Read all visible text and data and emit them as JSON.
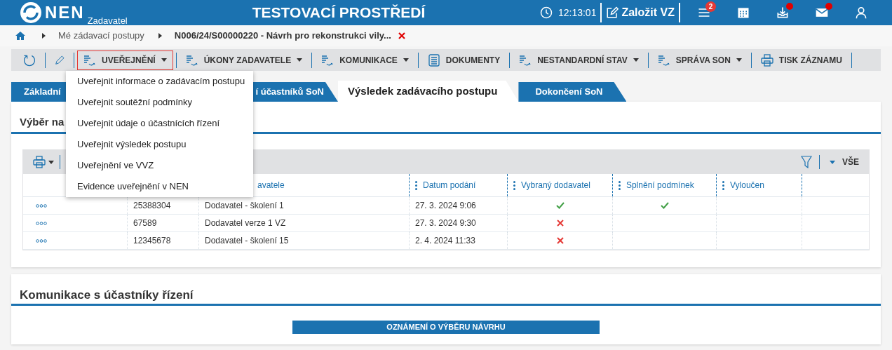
{
  "header": {
    "logo": "NEN",
    "logo_sub": "Zadavatel",
    "title": "TESTOVACÍ PROSTŘEDÍ",
    "time": "12:13:01",
    "create_button": "Založit VZ",
    "icons": [
      {
        "kind": "menu",
        "badge": "2",
        "dot": false
      },
      {
        "kind": "calendar",
        "dot": false
      },
      {
        "kind": "inbox",
        "dot": true
      },
      {
        "kind": "mail",
        "dot": true
      },
      {
        "kind": "user",
        "dot": false
      }
    ]
  },
  "breadcrumb": [
    "Mé zádavací postupy",
    "N006/24/S00000220 - Návrh pro rekonstrukci vily..."
  ],
  "toolbar": [
    {
      "kind": "refresh"
    },
    {
      "kind": "edit"
    },
    {
      "kind": "menu",
      "label": "UVEŘEJNĚNÍ",
      "active": true
    },
    {
      "kind": "menu",
      "label": "ÚKONY ZADAVATELE",
      "active": false
    },
    {
      "kind": "menu",
      "label": "KOMUNIKACE",
      "active": false
    },
    {
      "kind": "document",
      "label": "DOKUMENTY",
      "active": false
    },
    {
      "kind": "menu",
      "label": "NESTANDARDNÍ STAV",
      "active": false
    },
    {
      "kind": "menu",
      "label": "SPRÁVA SON",
      "active": false
    },
    {
      "kind": "print",
      "label": "TISK ZÁZNAMU",
      "active": false
    }
  ],
  "dropdown": [
    "Uveřejnit informace o zadávacím postupu",
    "Uveřejnit soutěžní podmínky",
    "Uveřejnit údaje o účastnících řízení",
    "Uveřejnit výsledek postupu",
    "Uveřejnění ve VVZ",
    "Evidence uveřejnění v NEN"
  ],
  "tabs": [
    {
      "label": "Základní",
      "selected": false
    },
    {
      "label": "í účastníků SoN",
      "selected": false
    },
    {
      "label": "Výsledek zadávacího postupu",
      "selected": true
    },
    {
      "label": "Dokončení SoN",
      "selected": false
    }
  ],
  "section1": {
    "title": "Výběr na",
    "filter_label": "VŠE",
    "columns": [
      {
        "kind": "handle"
      },
      {
        "kind": "blank"
      },
      {
        "kind": "text",
        "label": "avatele"
      },
      {
        "kind": "text",
        "label": "Datum podání"
      },
      {
        "kind": "text",
        "label": "Vybraný dodavatel"
      },
      {
        "kind": "text",
        "label": "Splnění podmínek"
      },
      {
        "kind": "text",
        "label": "Vyloučen"
      },
      {
        "kind": "blank"
      }
    ],
    "rows": [
      {
        "id": "25388304",
        "name": "Dodavatel - školení 1",
        "date": "27. 3. 2024 9:06",
        "supplier_selected": true,
        "conditions_met": true
      },
      {
        "id": "67589",
        "name": "Dodavatel verze 1 VZ",
        "date": "27. 3. 2024 9:30",
        "supplier_selected": false
      },
      {
        "id": "12345678",
        "name": "Dodavatel - školení 15",
        "date": "2. 4. 2024 11:33",
        "supplier_selected": false
      }
    ]
  },
  "section2": {
    "title": "Komunikace s účastníky řízení",
    "button": "OZNÁMENÍ O VÝBĚRU NÁVRHU"
  }
}
